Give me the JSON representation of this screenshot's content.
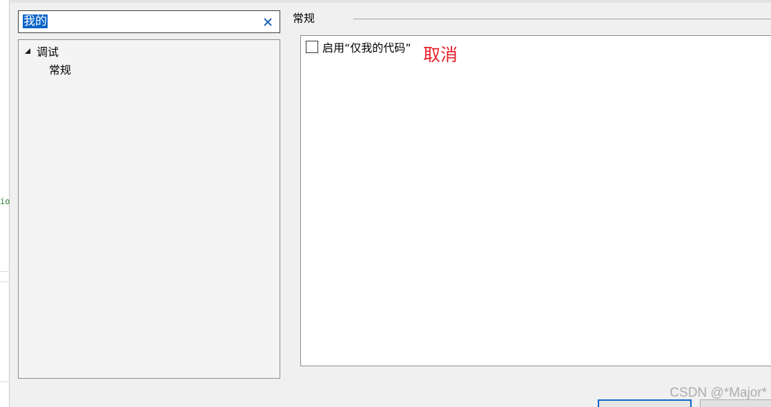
{
  "background_editor": {
    "code_fragment": "io"
  },
  "search": {
    "value": "我的",
    "clear_icon": "close-icon"
  },
  "tree": {
    "parent_label": "调试",
    "parent_expander_icon": "triangle-expanded-icon",
    "child_label": "常规"
  },
  "section": {
    "title": "常规"
  },
  "options": {
    "just_my_code_label": "启用“仅我的代码”",
    "just_my_code_checked": false
  },
  "annotation": {
    "text": "取消",
    "color": "#e8202a"
  },
  "watermark": {
    "text": "CSDN @*Major*"
  },
  "colors": {
    "selection": "#0a64c8",
    "dialog_bg": "#f0f0f0",
    "accent_border": "#0a64c8"
  }
}
